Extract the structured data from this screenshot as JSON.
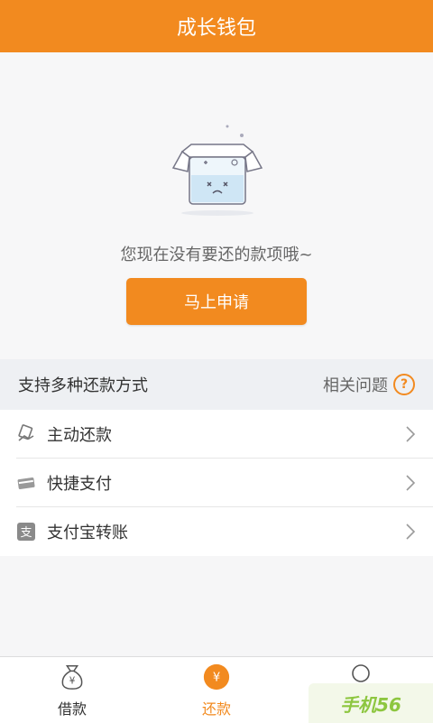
{
  "header": {
    "title": "成长钱包"
  },
  "empty_state": {
    "message": "您现在没有要还的款项哦~",
    "apply_button": "马上申请"
  },
  "section": {
    "title": "支持多种还款方式",
    "related_label": "相关问题",
    "related_icon": "question-circle-icon"
  },
  "methods": [
    {
      "label": "主动还款",
      "icon": "repay-hand-icon"
    },
    {
      "label": "快捷支付",
      "icon": "card-icon"
    },
    {
      "label": "支付宝转账",
      "icon": "alipay-icon"
    }
  ],
  "tabs": [
    {
      "label": "借款",
      "icon": "money-bag-icon"
    },
    {
      "label": "还款",
      "icon": "yen-circle-icon",
      "active": true
    },
    {
      "label": "",
      "icon": "user-icon"
    }
  ],
  "watermark": {
    "text": "手机56"
  },
  "colors": {
    "accent": "#f28a1f",
    "text": "#333333",
    "muted": "#666666"
  }
}
